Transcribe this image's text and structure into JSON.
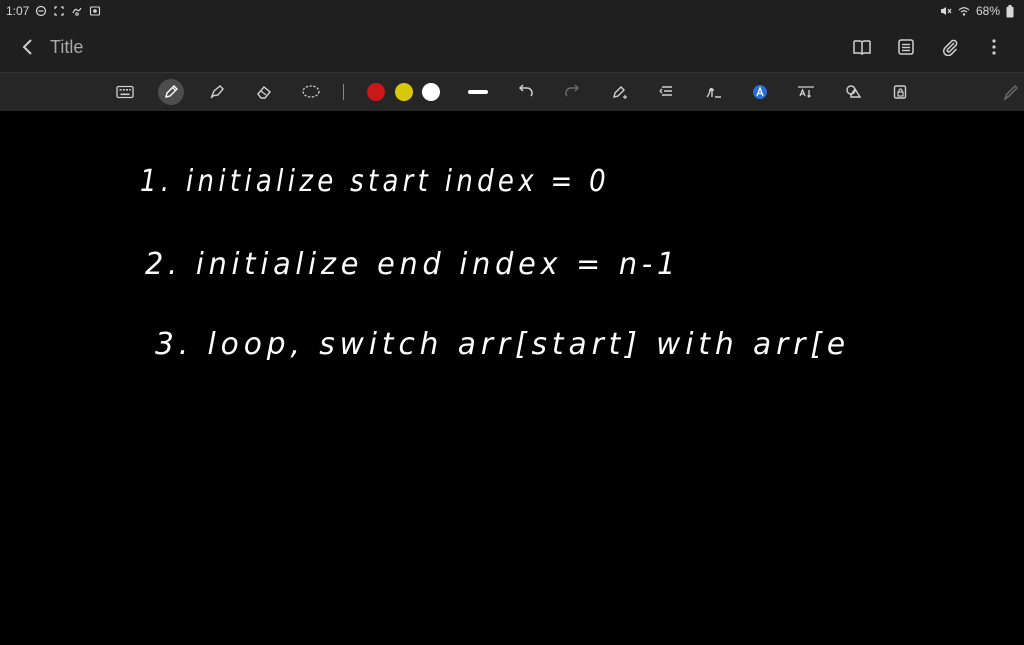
{
  "status": {
    "time": "1:07",
    "battery": "68%"
  },
  "note": {
    "title": "Title"
  },
  "colors": {
    "red": "#c9171c",
    "yellow": "#d8c80a",
    "white": "#ffffff"
  },
  "icons": {
    "titlebar": [
      "back-icon",
      "book-icon",
      "list-icon",
      "paperclip-icon",
      "more-icon"
    ],
    "toolbar": [
      "keyboard-icon",
      "pen-icon",
      "highlighter-icon",
      "eraser-icon",
      "lasso-icon",
      "stroke-width-icon",
      "undo-icon",
      "redo-icon",
      "pen-settings-icon",
      "text-align-icon",
      "handwriting-to-text-icon",
      "text-style-icon",
      "text-size-icon",
      "shapes-icon",
      "lock-icon",
      "drawing-pen-icon"
    ]
  },
  "handwriting": {
    "line1": "1. initialize start index = 0",
    "line2": "2. initialize end index = n-1",
    "line3": "3. loop, switch arr[start] with arr[e"
  }
}
